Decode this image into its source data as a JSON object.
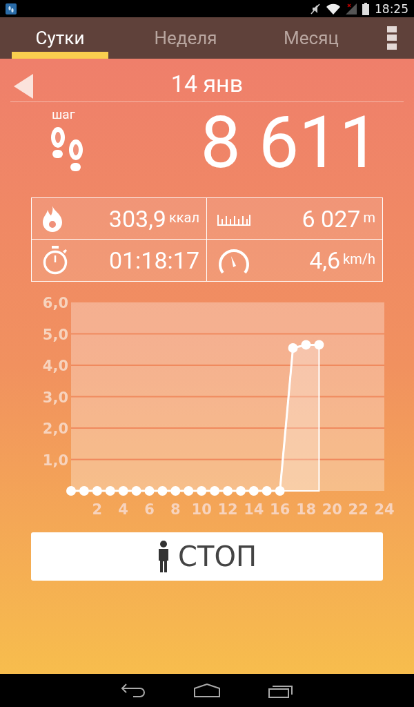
{
  "status_bar": {
    "time": "18:25"
  },
  "tabs": [
    {
      "label": "Сутки",
      "selected": true
    },
    {
      "label": "Неделя",
      "selected": false
    },
    {
      "label": "Месяц",
      "selected": false
    }
  ],
  "date": "14 янв",
  "steps": {
    "label": "шаг",
    "value": "8 611"
  },
  "stats": [
    {
      "kind": "calories",
      "value": "303,9",
      "unit": "ккал"
    },
    {
      "kind": "distance",
      "value": "6 027",
      "unit": "m"
    },
    {
      "kind": "duration",
      "value": "01:18:17"
    },
    {
      "kind": "speed",
      "value": "4,6",
      "unit": "km/h"
    }
  ],
  "chart": {
    "chart_data": {
      "type": "line",
      "x": [
        0,
        1,
        2,
        3,
        4,
        5,
        6,
        7,
        8,
        9,
        10,
        11,
        12,
        13,
        14,
        15,
        16,
        17,
        18,
        19
      ],
      "grid": true,
      "series": [
        {
          "color": "#ffffff",
          "marker": "circle",
          "values": [
            0,
            0,
            0,
            0,
            0,
            0,
            0,
            0,
            0,
            0,
            0,
            0,
            0,
            0,
            0,
            0,
            0,
            4.55,
            4.65,
            4.65
          ]
        }
      ],
      "xlim": [
        0,
        24
      ],
      "ylim": [
        0,
        6
      ],
      "xticks": [
        2,
        4,
        6,
        8,
        10,
        12,
        14,
        16,
        18,
        20,
        22,
        24
      ],
      "yticks": [
        {
          "value": 1,
          "label": "1,0"
        },
        {
          "value": 2,
          "label": "2,0"
        },
        {
          "value": 3,
          "label": "3,0"
        },
        {
          "value": 4,
          "label": "4,0"
        },
        {
          "value": 5,
          "label": "5,0"
        },
        {
          "value": 6,
          "label": "6,0"
        }
      ]
    }
  },
  "stop_button": {
    "label": "СТОП"
  }
}
